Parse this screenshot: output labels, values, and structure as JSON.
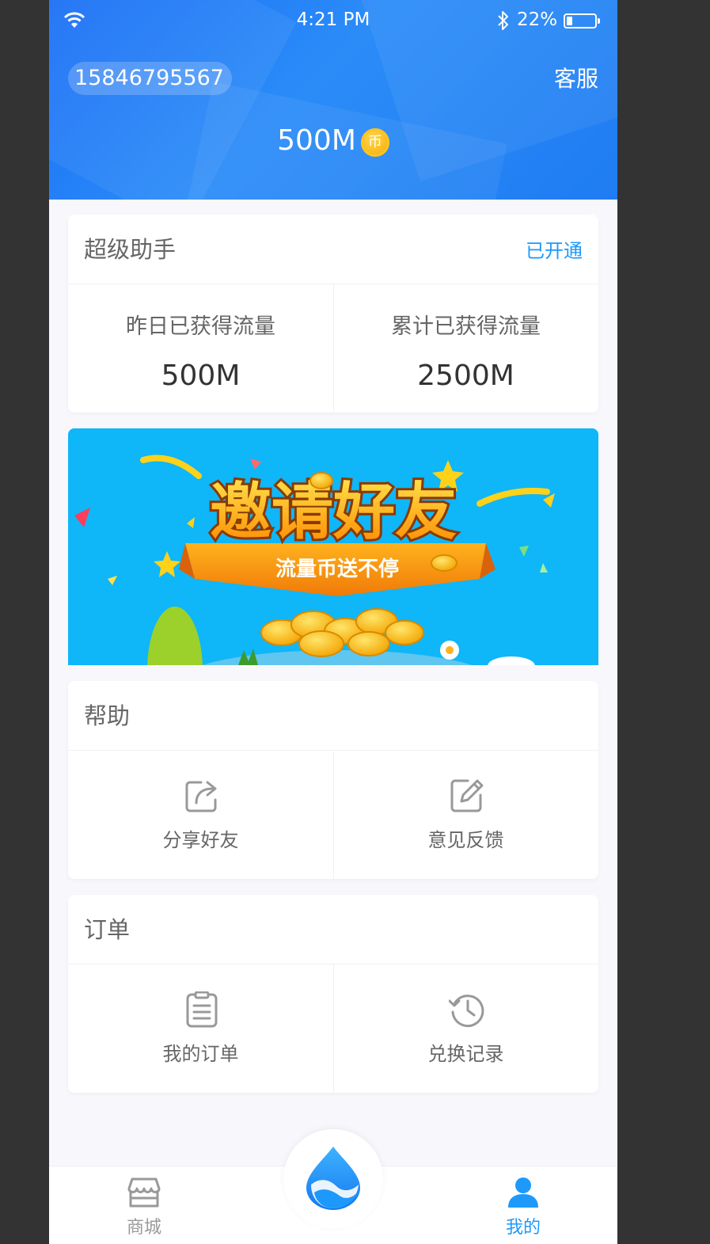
{
  "status_bar": {
    "time": "4:21 PM",
    "battery_percent": "22%",
    "battery_level": 0.22
  },
  "header": {
    "phone_number": "15846795567",
    "service_label": "客服",
    "balance": "500M",
    "coin_glyph": "币"
  },
  "assistant": {
    "title": "超级助手",
    "status": "已开通",
    "yesterday_label": "昨日已获得流量",
    "yesterday_value": "500M",
    "total_label": "累计已获得流量",
    "total_value": "2500M"
  },
  "banner": {
    "title": "邀请好友",
    "subtitle": "流量币送不停"
  },
  "help": {
    "title": "帮助",
    "items": [
      {
        "label": "分享好友",
        "icon": "share-icon"
      },
      {
        "label": "意见反馈",
        "icon": "feedback-edit-icon"
      }
    ]
  },
  "orders": {
    "title": "订单",
    "items": [
      {
        "label": "我的订单",
        "icon": "order-list-icon"
      },
      {
        "label": "兑换记录",
        "icon": "history-clock-icon"
      }
    ]
  },
  "tabbar": {
    "items": [
      {
        "label": "商城",
        "icon": "store-icon"
      },
      {
        "label": "",
        "icon": "water-drop-icon"
      },
      {
        "label": "我的",
        "icon": "user-icon"
      }
    ]
  },
  "colors": {
    "accent": "#1d99fb",
    "text_primary": "#333333",
    "text_secondary": "#666666",
    "divider": "#f0f0f0",
    "page_bg": "#f8f8fc",
    "card_bg": "#ffffff",
    "tab_inactive": "#999999"
  }
}
